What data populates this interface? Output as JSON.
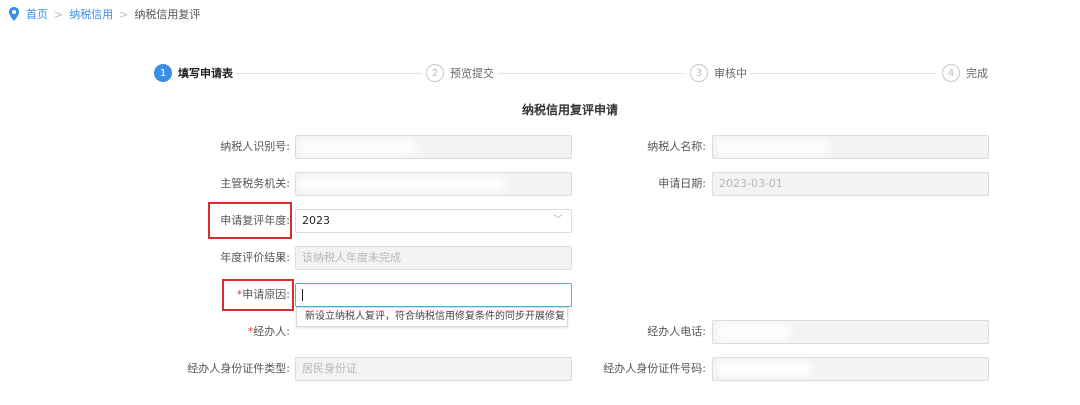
{
  "breadcrumb": {
    "icon": "location-pin-icon",
    "home": "首页",
    "section": "纳税信用",
    "current": "纳税信用复评",
    "separator": ">"
  },
  "steps": [
    {
      "num": "1",
      "label": "填写申请表",
      "active": true
    },
    {
      "num": "2",
      "label": "预览提交",
      "active": false
    },
    {
      "num": "3",
      "label": "审核中",
      "active": false
    },
    {
      "num": "4",
      "label": "完成",
      "active": false
    }
  ],
  "form": {
    "title": "纳税信用复评申请",
    "taxpayer_id": {
      "label": "纳税人识别号:",
      "value": ""
    },
    "taxpayer_name": {
      "label": "纳税人名称:",
      "value": ""
    },
    "tax_authority": {
      "label": "主管税务机关:",
      "value": ""
    },
    "apply_date": {
      "label": "申请日期:",
      "value": "2023-03-01"
    },
    "review_year": {
      "label": "申请复评年度:",
      "value": "2023"
    },
    "annual_result": {
      "label": "年度评价结果:",
      "value": "该纳税人年度未完成"
    },
    "reason": {
      "label": "申请原因:",
      "value": "",
      "required_mark": "*"
    },
    "reason_suggestion": "新设立纳税人复评，符合纳税信用修复条件的同步开展修复",
    "agent": {
      "label": "经办人:",
      "value": "",
      "required_mark": "*"
    },
    "agent_phone": {
      "label": "经办人电话:",
      "value": ""
    },
    "agent_id_type": {
      "label": "经办人身份证件类型:",
      "value": "居民身份证"
    },
    "agent_id_number": {
      "label": "经办人身份证件号码:",
      "value": ""
    }
  },
  "colors": {
    "accent": "#3a8ee6",
    "highlight": "#d32f2f",
    "focus_border": "#4fb2d9",
    "required": "#e53935"
  }
}
